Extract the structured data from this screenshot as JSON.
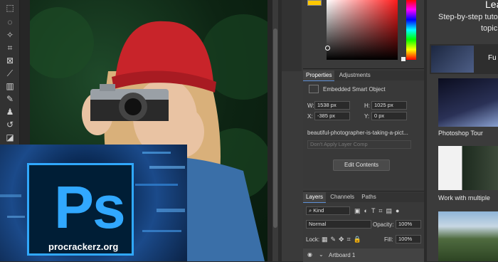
{
  "properties_panel": {
    "tab_properties": "Properties",
    "tab_adjustments": "Adjustments",
    "object_type": "Embedded Smart Object",
    "w_label": "W:",
    "w_value": "1538 px",
    "h_label": "H:",
    "h_value": "1025 px",
    "x_label": "X:",
    "x_value": "-385 px",
    "y_label": "Y:",
    "y_value": "0 px",
    "filename": "beautiful-photographer-is-taking-a-pict...",
    "layer_comp_placeholder": "Don't Apply Layer Comp",
    "edit_contents_label": "Edit Contents"
  },
  "layers_panel": {
    "tab_layers": "Layers",
    "tab_channels": "Channels",
    "tab_paths": "Paths",
    "filter_kind": "Kind",
    "blend_mode": "Normal",
    "opacity_label": "Opacity:",
    "opacity_value": "100%",
    "lock_label": "Lock:",
    "fill_label": "Fill:",
    "fill_value": "100%",
    "layer_name": "Artboard 1"
  },
  "learn_panel": {
    "title": "Lea",
    "subtitle_line1": "Step-by-step tutor",
    "subtitle_line2": "topic",
    "item1_caption": "Fu",
    "item2_caption": "Photoshop Tour",
    "item3_caption": "Work with multiple"
  },
  "overlay": {
    "logo_text": "Ps",
    "site_text": "procrackerz.org"
  },
  "colors": {
    "foreground_swatch": "#ffc800",
    "accent_blue": "#31a8ff"
  }
}
